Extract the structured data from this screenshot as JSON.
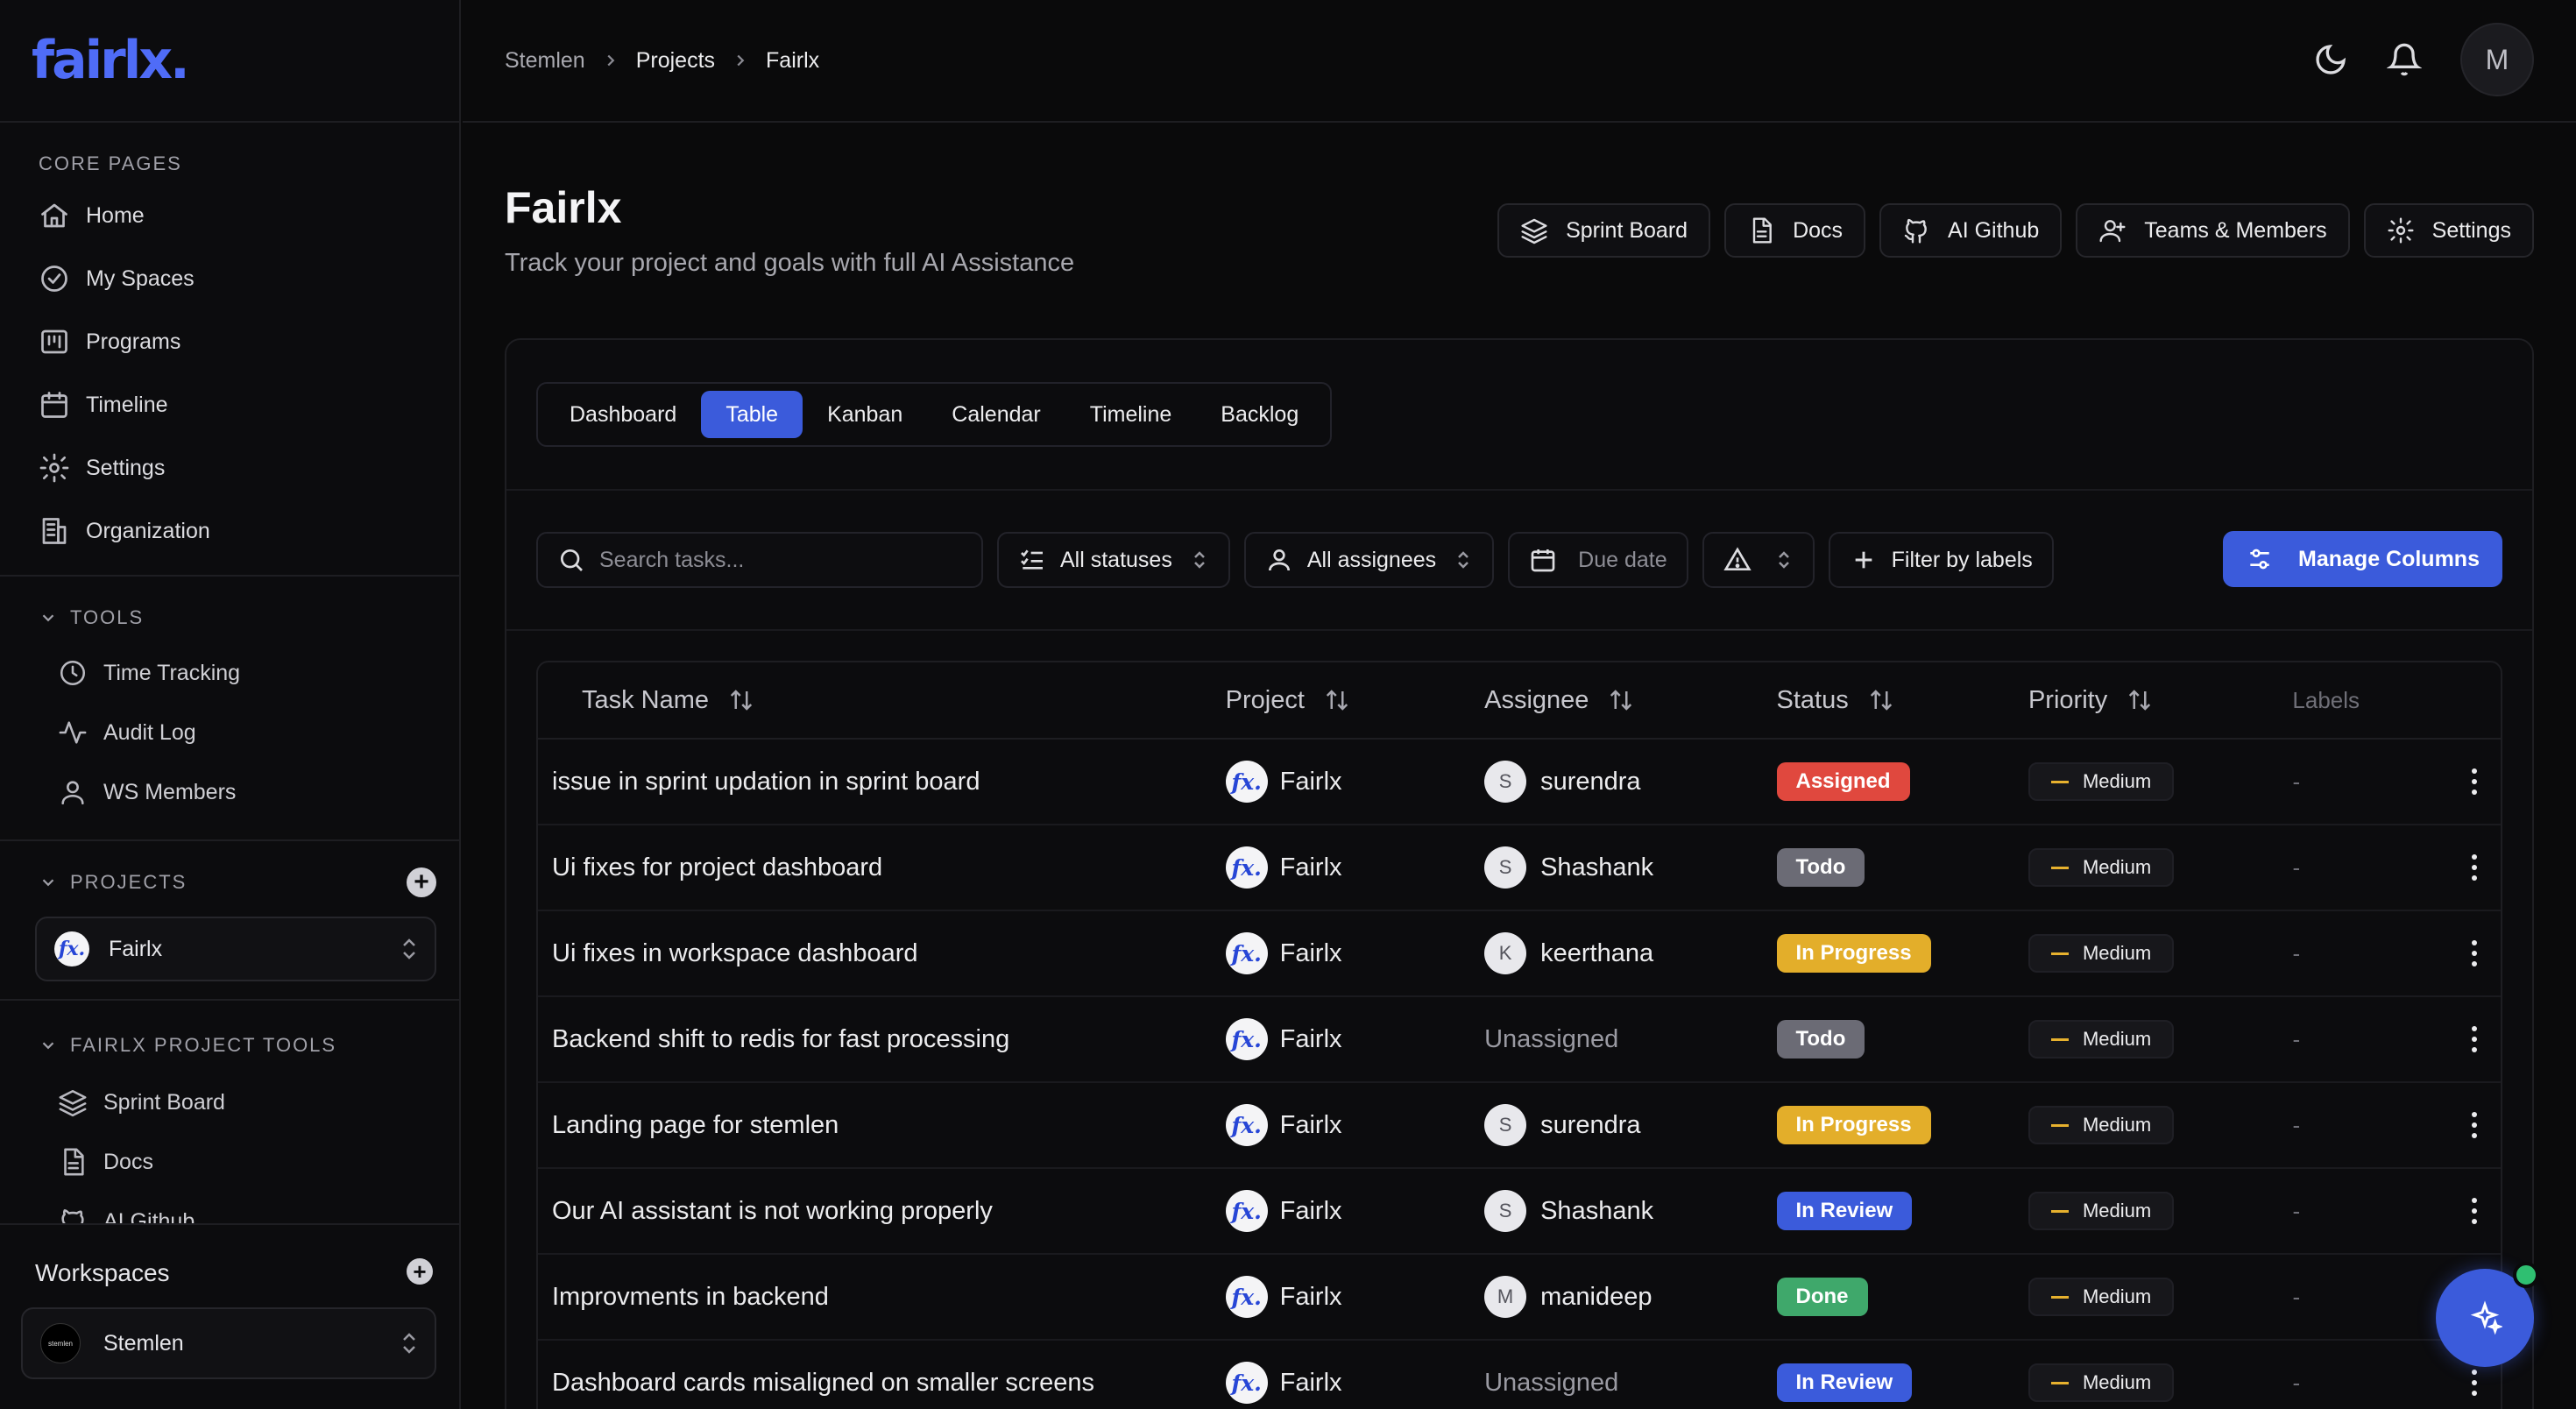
{
  "sidebar": {
    "logo": "fairlx.",
    "core_pages_title": "CORE PAGES",
    "core_pages": [
      {
        "label": "Home",
        "icon": "home-icon"
      },
      {
        "label": "My Spaces",
        "icon": "check-circle-icon"
      },
      {
        "label": "Programs",
        "icon": "kanban-icon"
      },
      {
        "label": "Timeline",
        "icon": "calendar-icon"
      },
      {
        "label": "Settings",
        "icon": "gear-icon"
      },
      {
        "label": "Organization",
        "icon": "building-icon"
      }
    ],
    "tools_title": "TOOLS",
    "tools": [
      {
        "label": "Time Tracking",
        "icon": "clock-icon"
      },
      {
        "label": "Audit Log",
        "icon": "activity-icon"
      },
      {
        "label": "WS Members",
        "icon": "user-icon"
      }
    ],
    "projects_title": "PROJECTS",
    "selected_project": "Fairlx",
    "project_tools_title": "FAIRLX PROJECT TOOLS",
    "project_tools": [
      {
        "label": "Sprint Board",
        "icon": "layers-icon"
      },
      {
        "label": "Docs",
        "icon": "document-icon"
      },
      {
        "label": "AI Github",
        "icon": "github-icon"
      }
    ],
    "workspaces_title": "Workspaces",
    "selected_workspace": "Stemlen",
    "workspace_logo_text": "stemlen"
  },
  "breadcrumb": [
    "Stemlen",
    "Projects",
    "Fairlx"
  ],
  "user_initial": "M",
  "header": {
    "title": "Fairlx",
    "subtitle": "Track your project and goals with full AI Assistance",
    "buttons": [
      {
        "label": "Sprint Board",
        "icon": "layers-icon"
      },
      {
        "label": "Docs",
        "icon": "document-icon"
      },
      {
        "label": "AI Github",
        "icon": "github-icon"
      },
      {
        "label": "Teams & Members",
        "icon": "user-plus-icon"
      },
      {
        "label": "Settings",
        "icon": "gear-icon"
      }
    ]
  },
  "view_tabs": [
    "Dashboard",
    "Table",
    "Kanban",
    "Calendar",
    "Timeline",
    "Backlog"
  ],
  "active_view": "Table",
  "filters": {
    "search_placeholder": "Search tasks...",
    "status": "All statuses",
    "assignee": "All assignees",
    "due_date": "Due date",
    "labels": "Filter by labels",
    "manage_columns": "Manage Columns"
  },
  "table": {
    "columns": [
      "Task Name",
      "Project",
      "Assignee",
      "Status",
      "Priority",
      "Labels"
    ],
    "rows": [
      {
        "task": "issue in sprint updation in sprint board",
        "project": "Fairlx",
        "assignee": "surendra",
        "initial": "S",
        "status": "Assigned",
        "priority": "Medium",
        "labels": "-"
      },
      {
        "task": "Ui fixes for project dashboard",
        "project": "Fairlx",
        "assignee": "Shashank",
        "initial": "S",
        "status": "Todo",
        "priority": "Medium",
        "labels": "-"
      },
      {
        "task": "Ui fixes in workspace dashboard",
        "project": "Fairlx",
        "assignee": "keerthana",
        "initial": "K",
        "status": "In Progress",
        "priority": "Medium",
        "labels": "-"
      },
      {
        "task": "Backend shift to redis for fast processing",
        "project": "Fairlx",
        "assignee": "Unassigned",
        "initial": "",
        "status": "Todo",
        "priority": "Medium",
        "labels": "-"
      },
      {
        "task": "Landing page for stemlen",
        "project": "Fairlx",
        "assignee": "surendra",
        "initial": "S",
        "status": "In Progress",
        "priority": "Medium",
        "labels": "-"
      },
      {
        "task": "Our AI assistant is not working properly",
        "project": "Fairlx",
        "assignee": "Shashank",
        "initial": "S",
        "status": "In Review",
        "priority": "Medium",
        "labels": "-"
      },
      {
        "task": "Improvments in backend",
        "project": "Fairlx",
        "assignee": "manideep",
        "initial": "M",
        "status": "Done",
        "priority": "Medium",
        "labels": "-"
      },
      {
        "task": "Dashboard cards misaligned on smaller screens",
        "project": "Fairlx",
        "assignee": "Unassigned",
        "initial": "",
        "status": "In Review",
        "priority": "Medium",
        "labels": "-"
      }
    ]
  },
  "colors": {
    "accent": "#3b5bdb",
    "status_assigned": "#e0483e",
    "status_todo": "#6b6b75",
    "status_in_progress": "#e3ae2a",
    "status_in_review": "#3b5bdb",
    "status_done": "#3fa86b",
    "priority_medium": "#e7b12e"
  }
}
